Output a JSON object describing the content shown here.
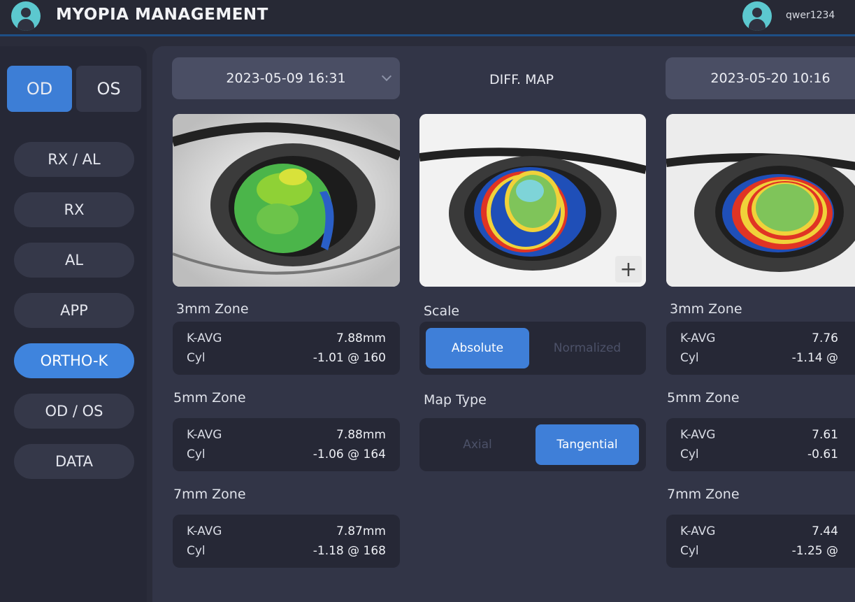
{
  "header": {
    "title": "MYOPIA MANAGEMENT",
    "username": "qwer1234"
  },
  "sidebar": {
    "eye_toggle": {
      "od": "OD",
      "os": "OS",
      "selected": "OD"
    },
    "nav": [
      {
        "label": "RX / AL",
        "active": false
      },
      {
        "label": "RX",
        "active": false
      },
      {
        "label": "AL",
        "active": false
      },
      {
        "label": "APP",
        "active": false
      },
      {
        "label": "ORTHO-K",
        "active": true
      },
      {
        "label": "OD / OS",
        "active": false
      },
      {
        "label": "DATA",
        "active": false
      }
    ]
  },
  "left": {
    "date": "2023-05-09 16:31",
    "zones": [
      {
        "name": "3mm Zone",
        "kavg_label": "K-AVG",
        "kavg": "7.88mm",
        "cyl_label": "Cyl",
        "cyl": "-1.01 @ 160"
      },
      {
        "name": "5mm Zone",
        "kavg_label": "K-AVG",
        "kavg": "7.88mm",
        "cyl_label": "Cyl",
        "cyl": "-1.06 @ 164"
      },
      {
        "name": "7mm Zone",
        "kavg_label": "K-AVG",
        "kavg": "7.87mm",
        "cyl_label": "Cyl",
        "cyl": "-1.18 @ 168"
      }
    ]
  },
  "center": {
    "title": "DIFF. MAP",
    "zoom": "+",
    "scale": {
      "label": "Scale",
      "options": [
        "Absolute",
        "Normalized"
      ],
      "selected": "Absolute"
    },
    "map_type": {
      "label": "Map Type",
      "options": [
        "Axial",
        "Tangential"
      ],
      "selected": "Tangential"
    }
  },
  "right": {
    "date": "2023-05-20 10:16",
    "zones": [
      {
        "name": "3mm Zone",
        "kavg_label": "K-AVG",
        "kavg": "7.76",
        "cyl_label": "Cyl",
        "cyl": "-1.14 @"
      },
      {
        "name": "5mm Zone",
        "kavg_label": "K-AVG",
        "kavg": "7.61",
        "cyl_label": "Cyl",
        "cyl": "-0.61"
      },
      {
        "name": "7mm Zone",
        "kavg_label": "K-AVG",
        "kavg": "7.44",
        "cyl_label": "Cyl",
        "cyl": "-1.25 @"
      }
    ]
  },
  "colors": {
    "accent": "#3f84dd",
    "header_bg": "#272935",
    "sidebar_bg": "#262836",
    "content_bg": "#323547",
    "card_bg": "#262836",
    "avatar": "#5cc8cf"
  }
}
